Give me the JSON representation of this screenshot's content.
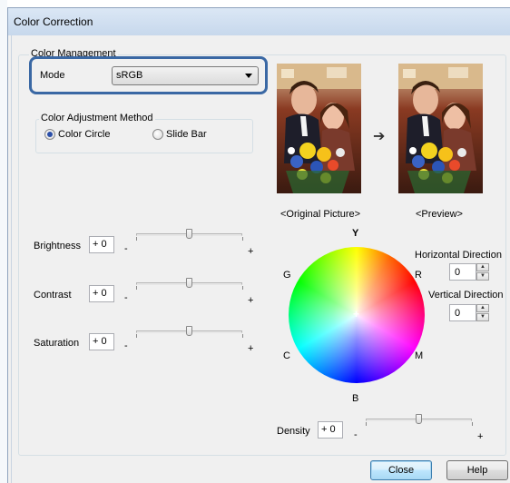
{
  "window": {
    "title": "Color Correction"
  },
  "color_management": {
    "legend": "Color Management",
    "mode_label": "Mode",
    "mode_value": "sRGB"
  },
  "adjustment_method": {
    "legend": "Color Adjustment Method",
    "options": [
      {
        "label": "Color Circle",
        "checked": true
      },
      {
        "label": "Slide Bar",
        "checked": false
      }
    ]
  },
  "sliders": [
    {
      "label": "Brightness",
      "value": "+ 0",
      "minus": "-",
      "plus": "+",
      "position": 0.5
    },
    {
      "label": "Contrast",
      "value": "+ 0",
      "minus": "-",
      "plus": "+",
      "position": 0.5
    },
    {
      "label": "Saturation",
      "value": "+ 0",
      "minus": "-",
      "plus": "+",
      "position": 0.5
    }
  ],
  "preview": {
    "original_label": "<Original Picture>",
    "preview_label": "<Preview>",
    "arrow_icon": "right-arrow-icon"
  },
  "color_circle": {
    "labels": {
      "top": "Y",
      "upper_left": "G",
      "upper_right": "R",
      "lower_left": "C",
      "lower_right": "M",
      "bottom": "B"
    },
    "center_mark": "+"
  },
  "directions": {
    "horizontal_label": "Horizontal Direction",
    "horizontal_value": "0",
    "vertical_label": "Vertical Direction",
    "vertical_value": "0"
  },
  "density": {
    "label": "Density",
    "value": "+ 0",
    "minus": "-",
    "plus": "+",
    "position": 0.5
  },
  "buttons": {
    "close": "Close",
    "help": "Help"
  },
  "colors": {
    "highlight_border": "#3a68a4",
    "title_bar": "#c7d8ec",
    "radio_dot": "#2b4fa8"
  }
}
